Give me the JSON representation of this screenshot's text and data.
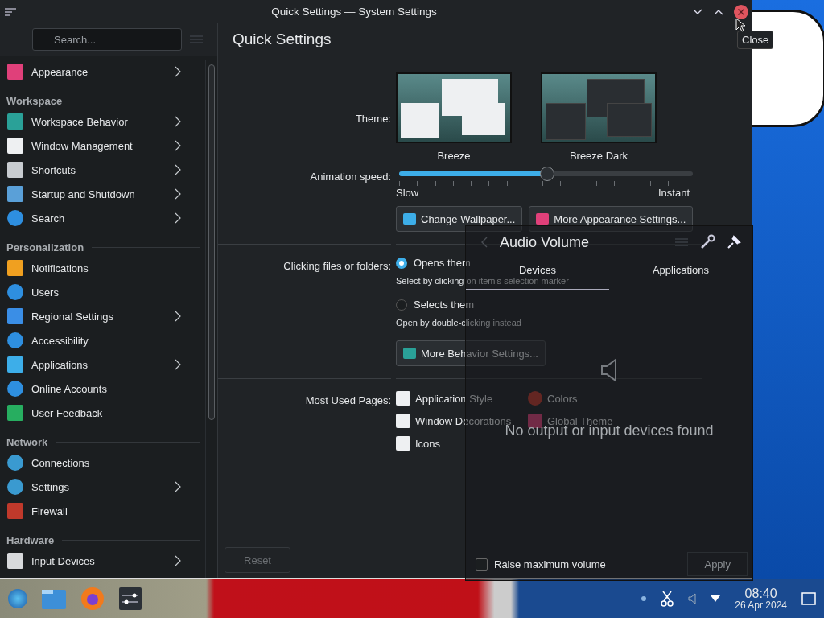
{
  "window": {
    "title": "Quick Settings — System Settings",
    "tooltip": "Close"
  },
  "sidebar": {
    "search": {
      "placeholder": "Search..."
    },
    "sections": [
      {
        "items": [
          {
            "label": "Appearance",
            "has_children": true
          }
        ]
      },
      {
        "heading": "Workspace",
        "items": [
          {
            "label": "Workspace Behavior",
            "has_children": true
          },
          {
            "label": "Window Management",
            "has_children": true
          },
          {
            "label": "Shortcuts",
            "has_children": true
          },
          {
            "label": "Startup and Shutdown",
            "has_children": true
          },
          {
            "label": "Search",
            "has_children": true
          }
        ]
      },
      {
        "heading": "Personalization",
        "items": [
          {
            "label": "Notifications",
            "has_children": false
          },
          {
            "label": "Users",
            "has_children": false
          },
          {
            "label": "Regional Settings",
            "has_children": true
          },
          {
            "label": "Accessibility",
            "has_children": false
          },
          {
            "label": "Applications",
            "has_children": true
          },
          {
            "label": "Online Accounts",
            "has_children": false
          },
          {
            "label": "User Feedback",
            "has_children": false
          }
        ]
      },
      {
        "heading": "Network",
        "items": [
          {
            "label": "Connections",
            "has_children": false
          },
          {
            "label": "Settings",
            "has_children": true
          },
          {
            "label": "Firewall",
            "has_children": false
          }
        ]
      },
      {
        "heading": "Hardware",
        "items": [
          {
            "label": "Input Devices",
            "has_children": true
          }
        ]
      }
    ]
  },
  "page": {
    "title": "Quick Settings",
    "theme": {
      "label": "Theme:",
      "options": [
        "Breeze",
        "Breeze Dark"
      ]
    },
    "animation": {
      "label": "Animation speed:",
      "level": 0.5,
      "min_label": "Slow",
      "max_label": "Instant"
    },
    "appearance_buttons": [
      "Change Wallpaper...",
      "More Appearance Settings..."
    ],
    "clicking": {
      "label": "Clicking files or folders:",
      "options": [
        {
          "label": "Opens them",
          "hint": "Select by clicking on item's selection marker",
          "selected": true
        },
        {
          "label": "Selects them",
          "hint": "Open by double-clicking instead",
          "selected": false
        }
      ]
    },
    "behavior_button": "More Behavior Settings...",
    "most_used": {
      "label": "Most Used Pages:",
      "pages": [
        "Application Style",
        "Colors",
        "Window Decorations",
        "Global Theme",
        "Icons"
      ]
    },
    "reset_button": "Reset"
  },
  "audio_popup": {
    "title": "Audio Volume",
    "tabs": [
      {
        "label": "Devices",
        "selected": true
      },
      {
        "label": "Applications",
        "selected": false
      }
    ],
    "message": "No output or input devices found",
    "raise_max": {
      "label": "Raise maximum volume",
      "checked": false
    },
    "apply_button": "Apply"
  },
  "taskbar": {
    "time": "08:40",
    "date": "26 Apr 2024"
  }
}
